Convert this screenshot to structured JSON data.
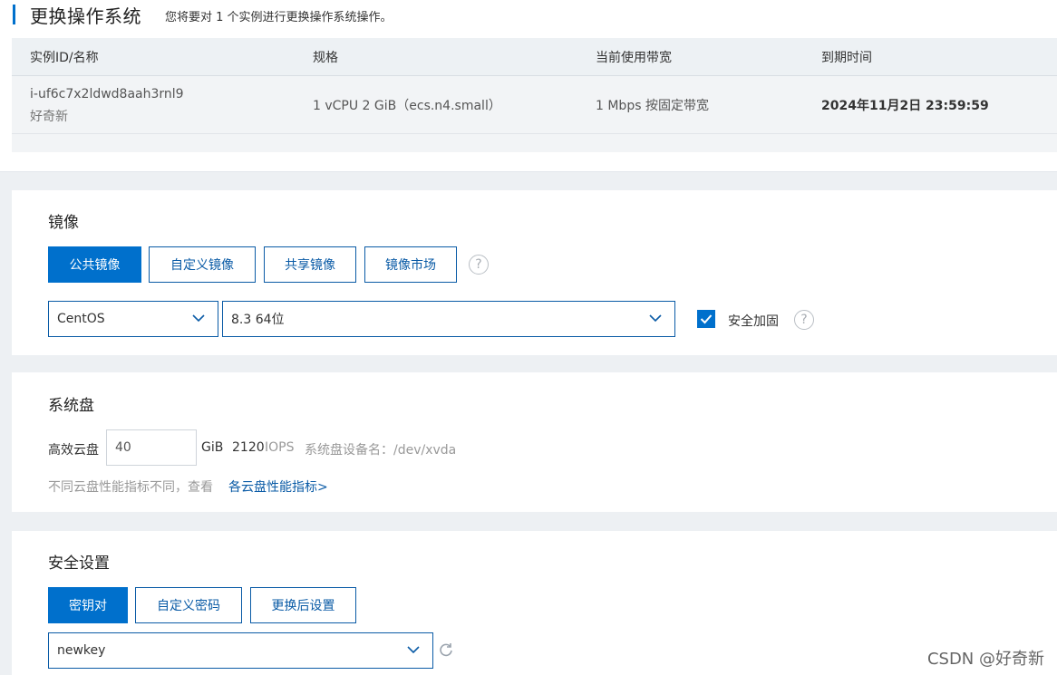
{
  "header": {
    "title": "更换操作系统",
    "subtitle": "您将要对 1 个实例进行更换操作系统操作。"
  },
  "instance_table": {
    "columns": [
      "实例ID/名称",
      "规格",
      "当前使用带宽",
      "到期时间"
    ],
    "rows": [
      {
        "id": "i-uf6c7x2ldwd8aah3rnl9",
        "name": "好奇新",
        "spec": "1 vCPU 2 GiB（ecs.n4.small）",
        "bandwidth": "1 Mbps 按固定带宽",
        "expire": "2024年11月2日 23:59:59"
      }
    ]
  },
  "image_section": {
    "title": "镜像",
    "tabs": [
      "公共镜像",
      "自定义镜像",
      "共享镜像",
      "镜像市场"
    ],
    "active_tab": 0,
    "os_select": "CentOS",
    "version_select": "8.3 64位",
    "security_hardening_label": "安全加固",
    "security_hardening_checked": true
  },
  "disk_section": {
    "title": "系统盘",
    "type_label": "高效云盘",
    "size_value": "40",
    "unit": "GiB",
    "iops_value": "2120",
    "iops_unit": "IOPS",
    "device_label": "系统盘设备名：/dev/xvda",
    "hint_text": "不同云盘性能指标不同，查看",
    "hint_link": "各云盘性能指标>"
  },
  "security_section": {
    "title": "安全设置",
    "tabs": [
      "密钥对",
      "自定义密码",
      "更换后设置"
    ],
    "active_tab": 0,
    "keypair_select": "newkey"
  },
  "watermark": "CSDN @好奇新",
  "colors": {
    "primary": "#0070cc",
    "border_blue": "#0a5ba6",
    "page_bg": "#edf0f3"
  },
  "icons": [
    "help-circle-icon",
    "chevron-down-icon",
    "check-icon",
    "refresh-icon"
  ]
}
